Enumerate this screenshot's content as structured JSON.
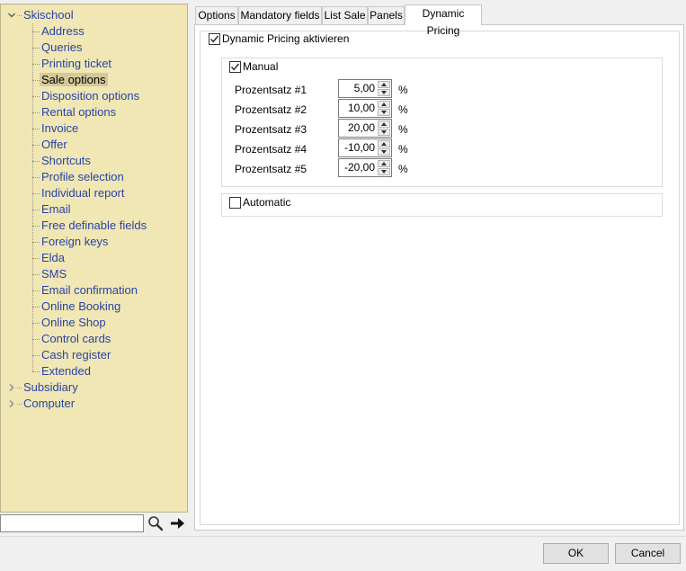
{
  "tree": {
    "root": {
      "label": "Skischool",
      "expanded": true
    },
    "children": [
      {
        "label": "Address"
      },
      {
        "label": "Queries"
      },
      {
        "label": "Printing ticket"
      },
      {
        "label": "Sale options",
        "selected": true
      },
      {
        "label": "Disposition options"
      },
      {
        "label": "Rental options"
      },
      {
        "label": "Invoice"
      },
      {
        "label": "Offer"
      },
      {
        "label": "Shortcuts"
      },
      {
        "label": "Profile selection"
      },
      {
        "label": "Individual report"
      },
      {
        "label": "Email"
      },
      {
        "label": "Free definable fields"
      },
      {
        "label": "Foreign keys"
      },
      {
        "label": "Elda"
      },
      {
        "label": "SMS"
      },
      {
        "label": "Email confirmation"
      },
      {
        "label": "Online Booking"
      },
      {
        "label": "Online Shop"
      },
      {
        "label": "Control cards"
      },
      {
        "label": "Cash register"
      },
      {
        "label": "Extended"
      }
    ],
    "siblings": [
      {
        "label": "Subsidiary",
        "expanded": false
      },
      {
        "label": "Computer",
        "expanded": false
      }
    ]
  },
  "search": {
    "value": "",
    "icon": "magnifier-icon",
    "go_icon": "arrow-right-icon"
  },
  "tabs": [
    {
      "label": "Options",
      "active": false
    },
    {
      "label": "Mandatory fields",
      "active": false
    },
    {
      "label": "List Sale",
      "active": false
    },
    {
      "label": "Panels",
      "active": false
    },
    {
      "label": "Dynamic Pricing",
      "active": true
    }
  ],
  "dynamic_pricing": {
    "activate_label": "Dynamic Pricing aktivieren",
    "activate_checked": true,
    "manual": {
      "label": "Manual",
      "checked": true,
      "rows": [
        {
          "label": "Prozentsatz #1",
          "value": "5,00",
          "unit": "%"
        },
        {
          "label": "Prozentsatz #2",
          "value": "10,00",
          "unit": "%"
        },
        {
          "label": "Prozentsatz #3",
          "value": "20,00",
          "unit": "%"
        },
        {
          "label": "Prozentsatz #4",
          "value": "-10,00",
          "unit": "%"
        },
        {
          "label": "Prozentsatz #5",
          "value": "-20,00",
          "unit": "%"
        }
      ]
    },
    "automatic": {
      "label": "Automatic",
      "checked": false
    }
  },
  "buttons": {
    "ok": "OK",
    "cancel": "Cancel"
  },
  "colors": {
    "tree_bg": "#f0e7b4",
    "tree_text": "#2a43a6",
    "selected_bg": "#d3c99a"
  }
}
